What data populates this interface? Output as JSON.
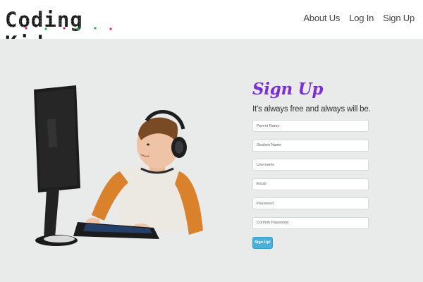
{
  "header": {
    "logo_text": "Coding Kids",
    "nav": [
      {
        "label": "About Us"
      },
      {
        "label": "Log In"
      },
      {
        "label": "Sign Up"
      }
    ]
  },
  "signup": {
    "title": "Sign Up",
    "subtitle": "It's always free and always will be.",
    "fields": [
      {
        "placeholder": "Parent Name",
        "value": ""
      },
      {
        "placeholder": "Student Name",
        "value": ""
      },
      {
        "placeholder": "Username",
        "value": ""
      },
      {
        "placeholder": "Email",
        "value": ""
      },
      {
        "placeholder": "Password",
        "value": ""
      },
      {
        "placeholder": "Confirm Password",
        "value": ""
      }
    ],
    "submit_label": "Sign Up!"
  },
  "colors": {
    "title": "#7c2fd6",
    "button": "#4ab0d9",
    "background": "#e9eaea"
  }
}
